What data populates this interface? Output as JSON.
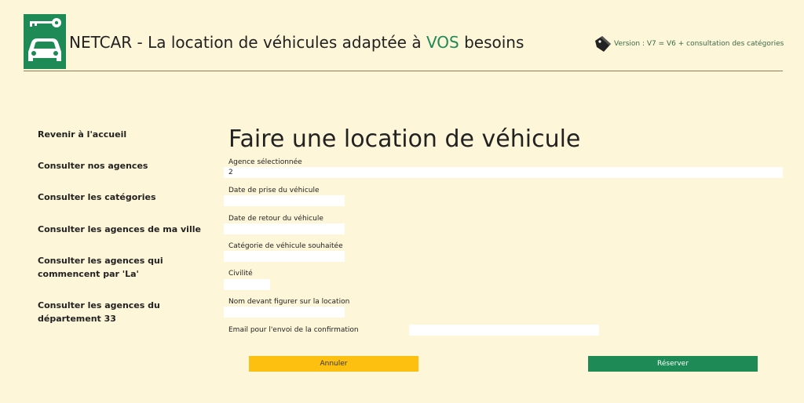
{
  "header": {
    "title_prefix": "NETCAR - La location de véhicules adaptée à ",
    "title_accent": "VOS",
    "title_suffix": " besoins",
    "version": "Version : V7 = V6 + consultation des catégories",
    "logo_icon": "car-key-icon",
    "version_icon": "tag-icon"
  },
  "sidebar": {
    "items": [
      {
        "label": "Revenir à l'accueil"
      },
      {
        "label": "Consulter nos agences"
      },
      {
        "label": "Consulter les catégories"
      },
      {
        "label": "Consulter les agences de ma ville"
      },
      {
        "label": "Consulter les agences qui commencent par 'La'"
      },
      {
        "label": "Consulter les agences du département 33"
      }
    ]
  },
  "form": {
    "title": "Faire une location de véhicule",
    "agence_label": "Agence sélectionnée",
    "agence_value": "2",
    "date_prise_label": "Date de prise du véhicule",
    "date_prise_value": "",
    "date_retour_label": "Date de retour du véhicule",
    "date_retour_value": "",
    "categorie_label": "Catégorie de véhicule souhaitée",
    "categorie_value": "",
    "civilite_label": "Civilité",
    "civilite_value": "",
    "nom_label": "Nom devant figurer sur la location",
    "nom_value": "",
    "email_label": "Email pour l'envoi de la confirmation",
    "email_value": "",
    "cancel_label": "Annuler",
    "submit_label": "Réserver"
  },
  "colors": {
    "background": "#fdf6d8",
    "accent_green": "#1e8a55",
    "cancel_yellow": "#fdc010"
  }
}
